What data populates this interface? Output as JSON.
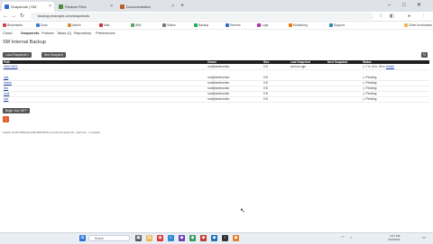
{
  "browser": {
    "tabs": [
      {
        "label": "Snapshots | SM",
        "active": true
      },
      {
        "label": "Restore Files",
        "active": false
      },
      {
        "label": "Documentation",
        "active": false
      }
    ],
    "new_tab_glyph": "+",
    "url": "backup.example.com/snapshots",
    "bookmarks": [
      "Bookmarks",
      "Docs",
      "Admin",
      "Mail",
      "Wiki",
      "Status",
      "Backup",
      "Servers",
      "Logs",
      "Monitoring",
      "Support"
    ],
    "bookmarks_right": "Other bookmarks"
  },
  "app_nav": {
    "logo": "Cloud",
    "items": [
      "Snapshots",
      "Policies",
      "Tasks (1)",
      "Repository",
      "Preferences"
    ],
    "active_index": 0
  },
  "page": {
    "title": "SM Internal Backup",
    "new_snapshot_label": "New Snapshot",
    "local_snapshots_label": "Local Snapshots ▾",
    "begin_label": "Begin Your VM™"
  },
  "table": {
    "headers": [
      "Path",
      "Owner",
      "Size",
      "Last Snapshot",
      "Next Snapshot",
      "Status"
    ],
    "rows": [
      {
        "path": "/SMI DATA",
        "owner": "root@smimonitor",
        "size": "0 B",
        "last": "an hour ago",
        "next": "",
        "status": "7 d, 16 h, 33 m",
        "delete": "Delete"
      },
      {
        "path": "/opt",
        "owner": "root@smimonitor",
        "size": "0 B",
        "last": "",
        "next": "",
        "status": "Pending",
        "delete": ""
      },
      {
        "path": "/home",
        "owner": "root@smimonitor",
        "size": "0 B",
        "last": "",
        "next": "",
        "status": "Pending",
        "delete": ""
      },
      {
        "path": "/etc",
        "owner": "root@smimonitor",
        "size": "0 B",
        "last": "",
        "next": "",
        "status": "Pending",
        "delete": ""
      },
      {
        "path": "/root",
        "owner": "root@smimonitor",
        "size": "0 B",
        "last": "",
        "next": "",
        "status": "Pending",
        "delete": ""
      },
      {
        "path": "/var",
        "owner": "root@smimonitor",
        "size": "0 B",
        "last": "",
        "next": "",
        "status": "Pending",
        "delete": ""
      }
    ]
  },
  "footer": {
    "version": "version v0.15.3 (9f3ce1) build 2024-03-01 on host sm-server-01 · user root · 7 d uptime"
  },
  "taskbar": {
    "search_placeholder": "Search",
    "time": "3:47 PM",
    "date": "3/14/2024"
  }
}
